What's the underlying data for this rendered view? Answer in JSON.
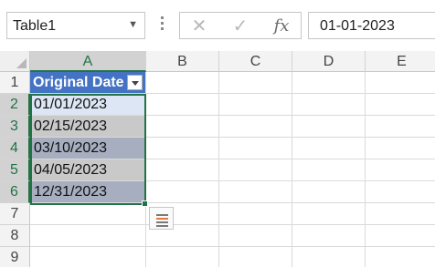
{
  "name_box": {
    "value": "Table1"
  },
  "formula_bar": {
    "cancel_symbol": "✕",
    "enter_symbol": "✓",
    "function_symbol": "fx",
    "value": "01-01-2023"
  },
  "columns": [
    "A",
    "B",
    "C",
    "D",
    "E"
  ],
  "selected_column": "A",
  "rows": [
    "1",
    "2",
    "3",
    "4",
    "5",
    "6",
    "7",
    "8",
    "9"
  ],
  "table": {
    "header": "Original Date",
    "values": [
      "01/01/2023",
      "02/15/2023",
      "03/10/2023",
      "04/05/2023",
      "12/31/2023"
    ]
  },
  "colors": {
    "table_header": "#4472c4",
    "selection_border": "#217346"
  }
}
